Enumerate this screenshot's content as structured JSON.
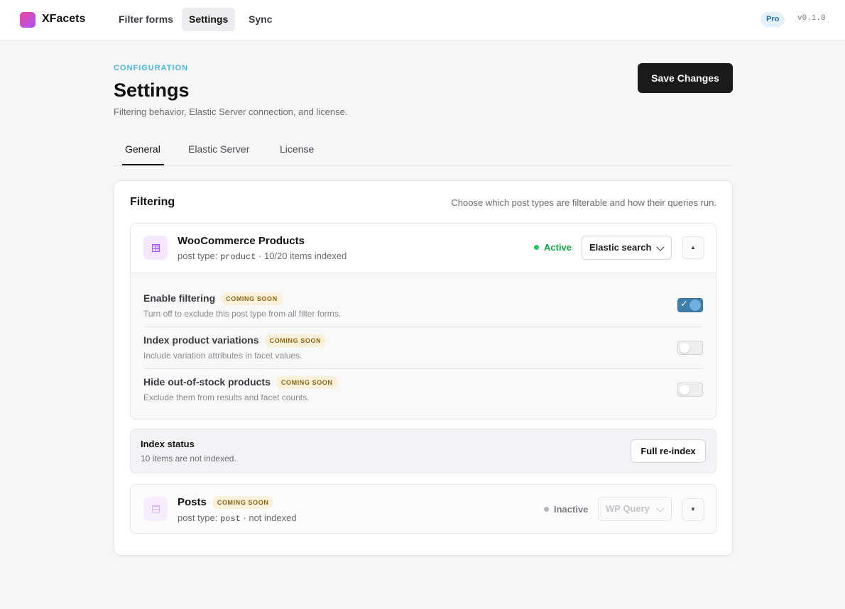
{
  "topbar": {
    "brand": "XFacets",
    "nav": [
      "Filter forms",
      "Settings",
      "Sync"
    ],
    "active_nav": "Settings",
    "badge": "Pro",
    "version": "v0.1.0"
  },
  "header": {
    "eyebrow": "CONFIGURATION",
    "title": "Settings",
    "description": "Filtering behavior, Elastic Server connection, and license.",
    "save_label": "Save Changes"
  },
  "tabs": [
    {
      "label": "General",
      "active": true
    },
    {
      "label": "Elastic Server",
      "active": false
    },
    {
      "label": "License",
      "active": false
    }
  ],
  "filtering": {
    "title": "Filtering",
    "description": "Choose which post types are filterable and how their queries run.",
    "woocommerce": {
      "name": "WooCommerce Products",
      "sub_prefix": "post type: ",
      "post_type": "product",
      "sub_suffix": " · 10/20 items indexed",
      "status": "Active",
      "status_color": "#22c55e",
      "engine": "Elastic search",
      "collapse_icon": "▲",
      "options": [
        {
          "label": "Enable filtering",
          "badge": "COMING SOON",
          "description": "Turn off to exclude this post type from all filter forms.",
          "enabled": true
        },
        {
          "label": "Index product variations",
          "badge": "COMING SOON",
          "description": "Include variation attributes in facet values.",
          "enabled": false
        },
        {
          "label": "Hide out-of-stock products",
          "badge": "COMING SOON",
          "description": "Exclude them from results and facet counts.",
          "enabled": false
        }
      ]
    },
    "index_status": {
      "title": "Index status",
      "description": "10 items are not indexed.",
      "button": "Full re-index"
    },
    "posts": {
      "name": "Posts",
      "badge": "COMING SOON",
      "sub_prefix": "post type: ",
      "post_type": "post",
      "sub_suffix": " · not indexed",
      "status": "Inactive",
      "status_color": "#9a9aa0",
      "engine": "WP Query",
      "expand_icon": "▼"
    }
  },
  "colors": {
    "accent": "#48b5e0",
    "primary_button": "#1a1a1a",
    "badge_bg": "#fbf0d9"
  }
}
